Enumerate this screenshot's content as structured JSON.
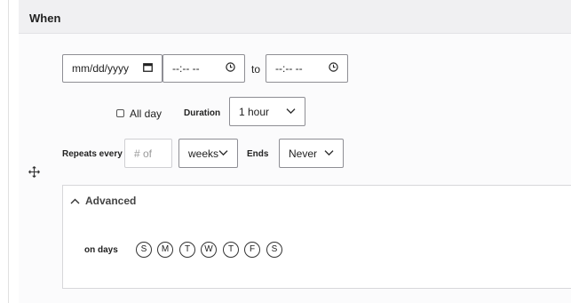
{
  "section": {
    "title": "When"
  },
  "start_date": {
    "placeholder": "mm/dd/yyyy",
    "icon": "calendar-icon"
  },
  "start_time": {
    "placeholder": "--:-- --",
    "icon": "clock-icon"
  },
  "to_label": "to",
  "end_time": {
    "placeholder": "--:-- --",
    "icon": "clock-icon"
  },
  "all_day": {
    "label": "All day",
    "checked": false
  },
  "duration": {
    "label": "Duration",
    "value": "1 hour",
    "icon": "chevron-down-icon"
  },
  "repeats": {
    "label": "Repeats every",
    "placeholder": "# of"
  },
  "frequency": {
    "value": "weeks",
    "icon": "chevron-down-icon"
  },
  "ends": {
    "label": "Ends",
    "value": "Never",
    "icon": "chevron-down-icon"
  },
  "advanced": {
    "label": "Advanced",
    "icon": "chevron-up-icon"
  },
  "on_days": {
    "label": "on days",
    "days": [
      "S",
      "M",
      "T",
      "W",
      "T",
      "F",
      "S"
    ]
  },
  "colors": {
    "panel_bg": "#fbfbfc",
    "header_bg": "#f0f0f2",
    "border": "#8e8e94"
  }
}
